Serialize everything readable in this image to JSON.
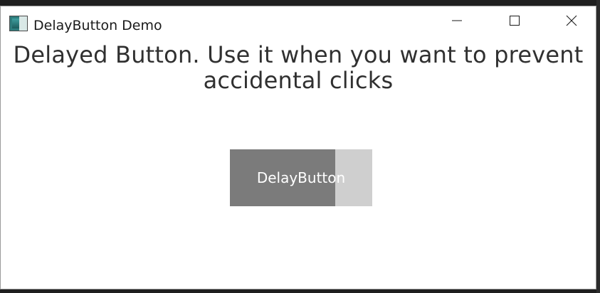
{
  "window": {
    "title": "DelayButton Demo"
  },
  "titlebar_controls": {
    "minimize": "minimize-icon",
    "maximize": "maximize-icon",
    "close": "close-icon"
  },
  "main": {
    "headline": "Delayed Button. Use it when you want to prevent accidental clicks",
    "delay_button": {
      "label": "DelayButton",
      "progress": 0.74,
      "fill_color": "#7b7b7b",
      "track_color": "#cfcfcf"
    }
  }
}
